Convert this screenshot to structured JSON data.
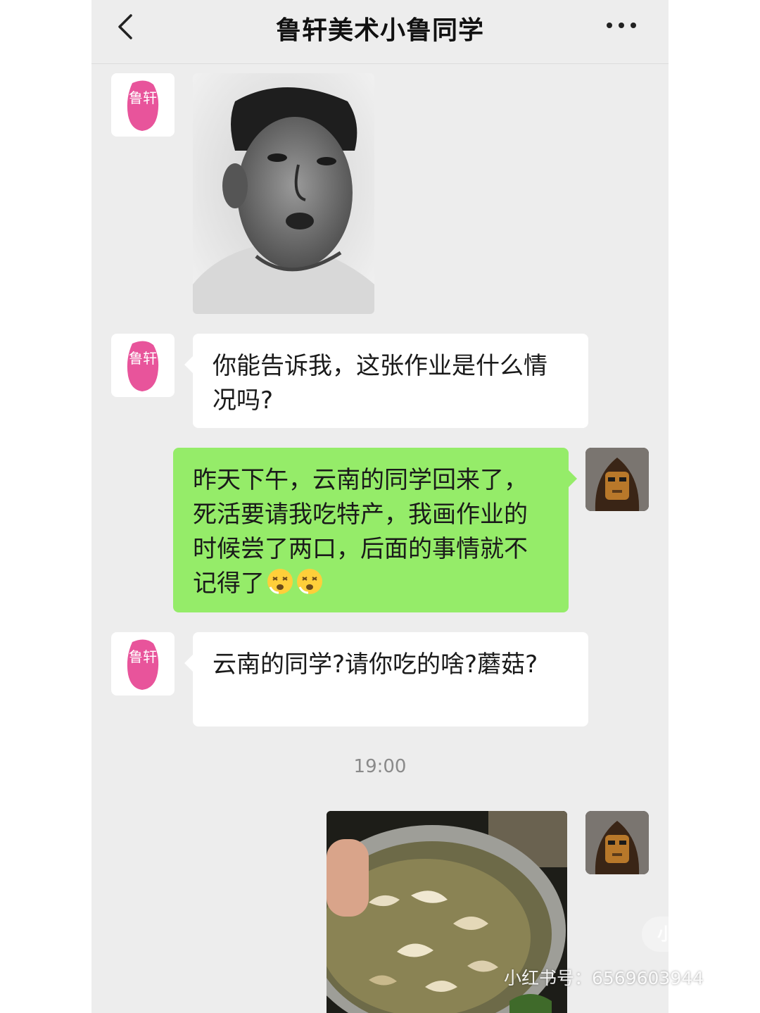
{
  "header": {
    "title": "鲁轩美术小鲁同学",
    "back_icon": "chevron-left-icon",
    "more_icon": "more-dots-icon"
  },
  "contact": {
    "avatar_text": "鲁轩",
    "avatar_color": "#e8549b"
  },
  "messages": [
    {
      "id": "m1",
      "sender": "contact",
      "type": "image",
      "description": "pencil-portrait-sketch"
    },
    {
      "id": "m2",
      "sender": "contact",
      "type": "text",
      "text": "你能告诉我，这张作业是什么情况吗?"
    },
    {
      "id": "m3",
      "sender": "me",
      "type": "text",
      "text": "昨天下午，云南的同学回来了，死活要请我吃特产，我画作业的时候尝了两口，后面的事情就不记得了",
      "emoji": [
        "dizzy-face-emoji",
        "dizzy-face-emoji"
      ]
    },
    {
      "id": "m4",
      "sender": "contact",
      "type": "text",
      "text": "云南的同学?请你吃的啥?蘑菇?"
    },
    {
      "id": "m5",
      "sender": "me",
      "type": "image",
      "description": "pot-of-mushroom-soup"
    }
  ],
  "timestamp": "19:00",
  "watermark": {
    "logo": "小红书",
    "id_text": "小红书号：6569603944"
  },
  "colors": {
    "chat_bg": "#ededed",
    "my_bubble": "#95ec69",
    "their_bubble": "#ffffff"
  }
}
